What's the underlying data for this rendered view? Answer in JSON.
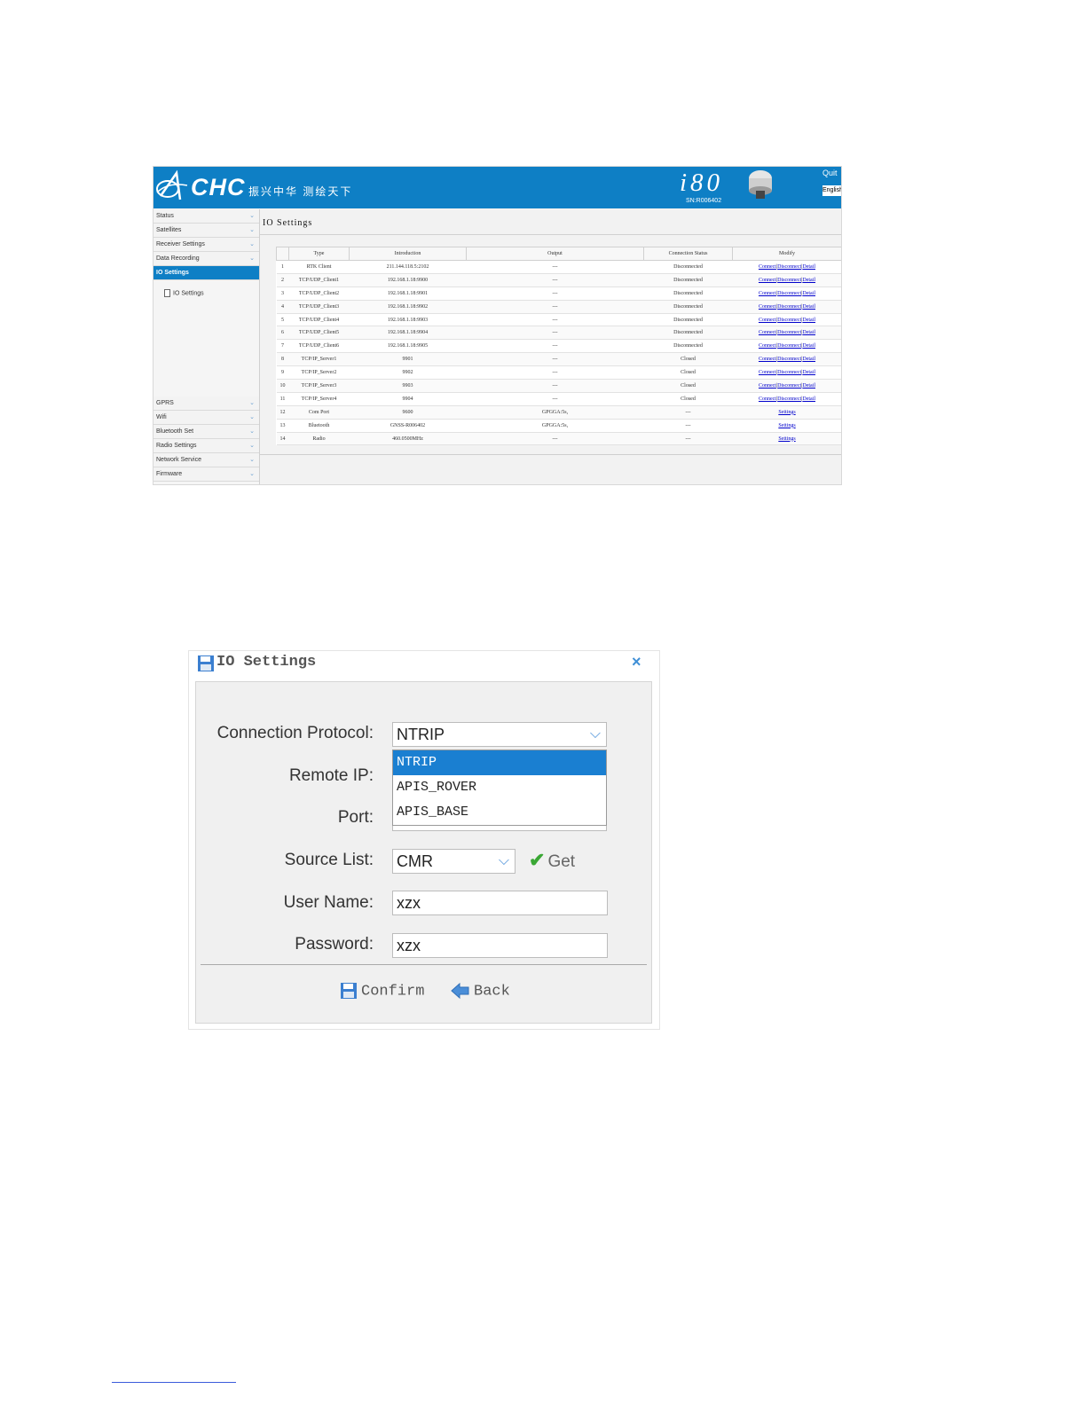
{
  "web_ui": {
    "brand": "CHC",
    "slogan": "振兴中华 测绘天下",
    "model": "i80",
    "serial": "SN:R006402",
    "quit_label": "Quit",
    "language_value": "English",
    "sidebar": {
      "items_top": [
        "Status",
        "Satellites",
        "Receiver Settings",
        "Data Recording",
        "IO Settings"
      ],
      "active_item": "IO Settings",
      "sub_item": "IO Settings",
      "items_bottom": [
        "GPRS",
        "Wifi",
        "Bluetooth Set",
        "Radio Settings",
        "Network Service",
        "Firmware"
      ]
    },
    "content_title": "IO Settings",
    "table": {
      "headers": [
        "",
        "Type",
        "Introduction",
        "Output",
        "Connection Status",
        "Modify"
      ],
      "rows": [
        {
          "no": "1",
          "type": "RTK Client",
          "intro": "211.144.118.5:2102",
          "output": "---",
          "status": "Disconnected",
          "modify": [
            "Connect",
            "Disconnect",
            "Detail"
          ]
        },
        {
          "no": "2",
          "type": "TCP/UDP_Client1",
          "intro": "192.168.1.18:9900",
          "output": "---",
          "status": "Disconnected",
          "modify": [
            "Connect",
            "Disconnect",
            "Detail"
          ]
        },
        {
          "no": "3",
          "type": "TCP/UDP_Client2",
          "intro": "192.168.1.18:9901",
          "output": "---",
          "status": "Disconnected",
          "modify": [
            "Connect",
            "Disconnect",
            "Detail"
          ]
        },
        {
          "no": "4",
          "type": "TCP/UDP_Client3",
          "intro": "192.168.1.18:9902",
          "output": "---",
          "status": "Disconnected",
          "modify": [
            "Connect",
            "Disconnect",
            "Detail"
          ]
        },
        {
          "no": "5",
          "type": "TCP/UDP_Client4",
          "intro": "192.168.1.18:9903",
          "output": "---",
          "status": "Disconnected",
          "modify": [
            "Connect",
            "Disconnect",
            "Detail"
          ]
        },
        {
          "no": "6",
          "type": "TCP/UDP_Client5",
          "intro": "192.168.1.18:9904",
          "output": "---",
          "status": "Disconnected",
          "modify": [
            "Connect",
            "Disconnect",
            "Detail"
          ]
        },
        {
          "no": "7",
          "type": "TCP/UDP_Client6",
          "intro": "192.168.1.18:9905",
          "output": "---",
          "status": "Disconnected",
          "modify": [
            "Connect",
            "Disconnect",
            "Detail"
          ]
        },
        {
          "no": "8",
          "type": "TCP/IP_Server1",
          "intro": "9901",
          "output": "---",
          "status": "Closed",
          "modify": [
            "Connect",
            "Disconnect",
            "Detail"
          ]
        },
        {
          "no": "9",
          "type": "TCP/IP_Server2",
          "intro": "9902",
          "output": "---",
          "status": "Closed",
          "modify": [
            "Connect",
            "Disconnect",
            "Detail"
          ]
        },
        {
          "no": "10",
          "type": "TCP/IP_Server3",
          "intro": "9903",
          "output": "---",
          "status": "Closed",
          "modify": [
            "Connect",
            "Disconnect",
            "Detail"
          ]
        },
        {
          "no": "11",
          "type": "TCP/IP_Server4",
          "intro": "9904",
          "output": "---",
          "status": "Closed",
          "modify": [
            "Connect",
            "Disconnect",
            "Detail"
          ]
        },
        {
          "no": "12",
          "type": "Com Port",
          "intro": "9600",
          "output": "GPGGA:5s,",
          "status": "---",
          "modify": [
            "Settings"
          ]
        },
        {
          "no": "13",
          "type": "Bluetooth",
          "intro": "GNSS-R006402",
          "output": "GPGGA:5s,",
          "status": "---",
          "modify": [
            "Settings"
          ]
        },
        {
          "no": "14",
          "type": "Radio",
          "intro": "460.0500MHz",
          "output": "---",
          "status": "---",
          "modify": [
            "Settings"
          ]
        }
      ]
    }
  },
  "dialog": {
    "title": "IO Settings",
    "close_label": "×",
    "labels": {
      "protocol": "Connection Protocol:",
      "remote_ip": "Remote IP:",
      "port": "Port:",
      "source_list": "Source List:",
      "user_name": "User Name:",
      "password": "Password:"
    },
    "protocol_value": "NTRIP",
    "protocol_options": [
      "NTRIP",
      "APIS_ROVER",
      "APIS_BASE"
    ],
    "protocol_selected_index": 0,
    "source_list_value": "CMR",
    "get_label": "Get",
    "user_name_value": "xzx",
    "password_value": "xzx",
    "confirm_label": "Confirm",
    "back_label": "Back",
    "icons": {
      "title": "floppy-disk-icon",
      "confirm": "floppy-disk-icon",
      "back": "back-arrow-icon",
      "get": "checkmark-icon",
      "dropdown": "chevron-down-icon"
    },
    "accent_color": "#1a7fd1"
  }
}
